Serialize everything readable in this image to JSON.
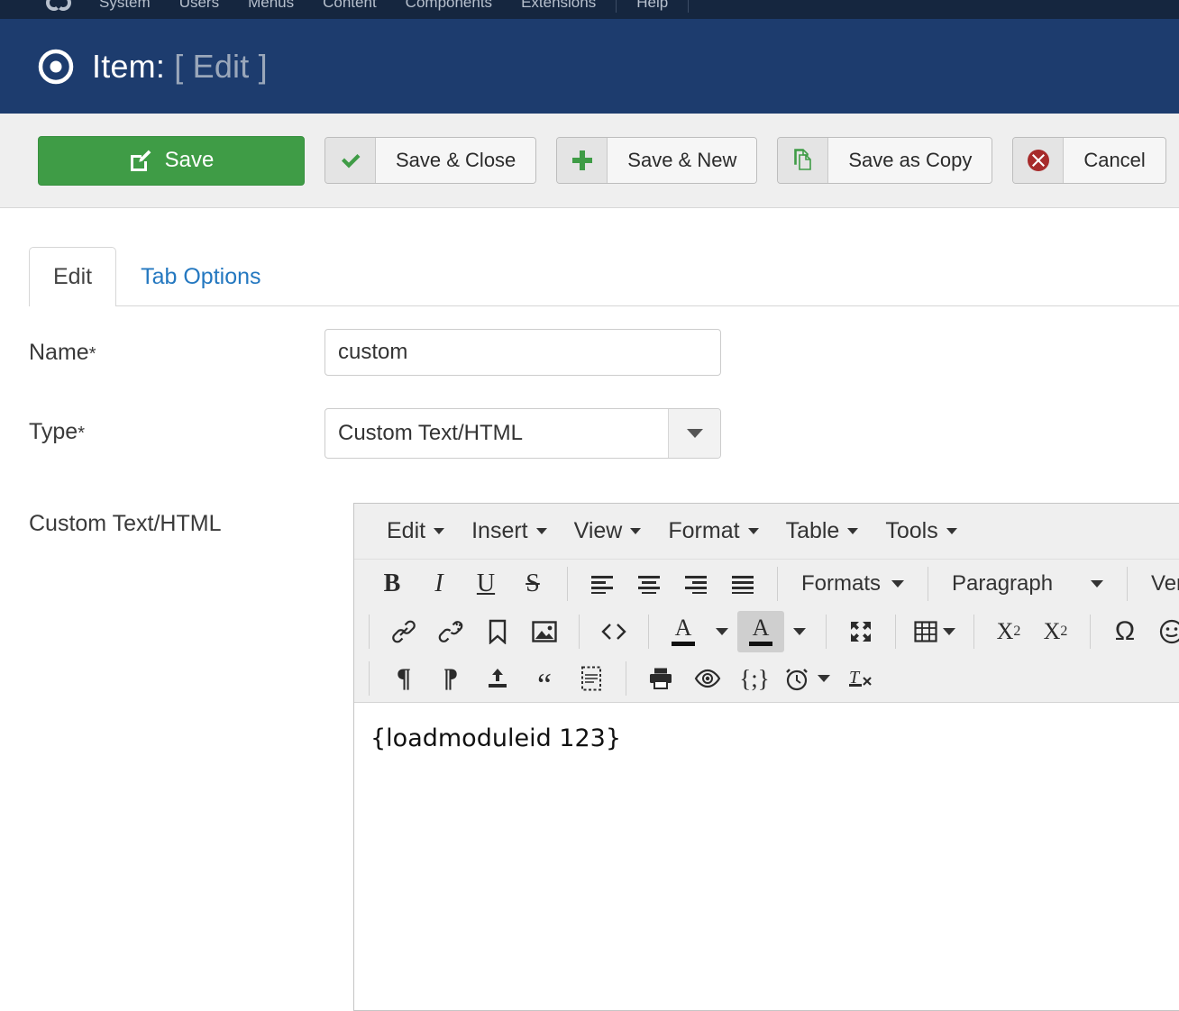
{
  "topbar": {
    "logo_icon": "joomla-logo-icon",
    "menu_items": [
      "System",
      "Users",
      "Menus",
      "Content",
      "Components",
      "Extensions",
      "Help"
    ],
    "right_items": [
      "site-icon",
      "user-icon"
    ]
  },
  "header": {
    "icon": "bullseye-icon",
    "title_prefix": "Item:",
    "title_suffix": "[ Edit ]"
  },
  "toolbar": {
    "buttons": [
      {
        "label": "Save",
        "icon": "pencil-square-icon",
        "style": "primary"
      },
      {
        "label": "Save & Close",
        "icon": "check-icon",
        "style": "default"
      },
      {
        "label": "Save & New",
        "icon": "plus-icon",
        "style": "default"
      },
      {
        "label": "Save as Copy",
        "icon": "copy-icon",
        "style": "default"
      },
      {
        "label": "Cancel",
        "icon": "times-circle-icon",
        "style": "default"
      }
    ],
    "colors": {
      "save_green": "#3f9c46",
      "check_green": "#3f9c46",
      "plus_green": "#3f9c46",
      "copy_green": "#3f9c46",
      "cancel_red": "#a72b2b"
    }
  },
  "tabs": [
    {
      "label": "Edit",
      "active": true
    },
    {
      "label": "Tab Options",
      "active": false
    }
  ],
  "form": {
    "name": {
      "label": "Name",
      "required_marker": "*",
      "value": "custom",
      "placeholder": ""
    },
    "type": {
      "label": "Type",
      "required_marker": "*",
      "value": "Custom Text/HTML",
      "options": [
        "Custom Text/HTML"
      ]
    },
    "custom_html": {
      "label": "Custom Text/HTML"
    }
  },
  "editor": {
    "menubar": [
      "Edit",
      "Insert",
      "View",
      "Format",
      "Table",
      "Tools"
    ],
    "toolbar_row1": [
      {
        "name": "bold-icon",
        "glyph": "B"
      },
      {
        "name": "italic-icon",
        "glyph": "I"
      },
      {
        "name": "underline-icon",
        "glyph": "U"
      },
      {
        "name": "strikethrough-icon",
        "glyph": "S"
      },
      {
        "name": "align-left-icon"
      },
      {
        "name": "align-center-icon"
      },
      {
        "name": "align-right-icon"
      },
      {
        "name": "align-justify-icon"
      }
    ],
    "formats_label": "Formats",
    "blockformat_label": "Paragraph",
    "fontfamily_label": "Verda",
    "toolbar_row2": [
      {
        "name": "link-icon"
      },
      {
        "name": "unlink-icon"
      },
      {
        "name": "anchor-icon"
      },
      {
        "name": "image-icon"
      },
      {
        "name": "source-code-icon"
      },
      {
        "name": "text-color-icon"
      },
      {
        "name": "background-color-icon"
      },
      {
        "name": "fullscreen-icon"
      },
      {
        "name": "table-icon"
      },
      {
        "name": "subscript-icon"
      },
      {
        "name": "superscript-icon"
      },
      {
        "name": "special-character-icon"
      },
      {
        "name": "emoticon-icon"
      }
    ],
    "toolbar_row3": [
      {
        "name": "ltr-icon"
      },
      {
        "name": "rtl-icon"
      },
      {
        "name": "insert-file-icon"
      },
      {
        "name": "blockquote-icon"
      },
      {
        "name": "page-break-icon"
      },
      {
        "name": "print-icon"
      },
      {
        "name": "preview-icon"
      },
      {
        "name": "code-snippet-icon"
      },
      {
        "name": "insert-datetime-icon"
      },
      {
        "name": "remove-format-icon"
      }
    ],
    "content": "{loadmoduleid 123}"
  }
}
